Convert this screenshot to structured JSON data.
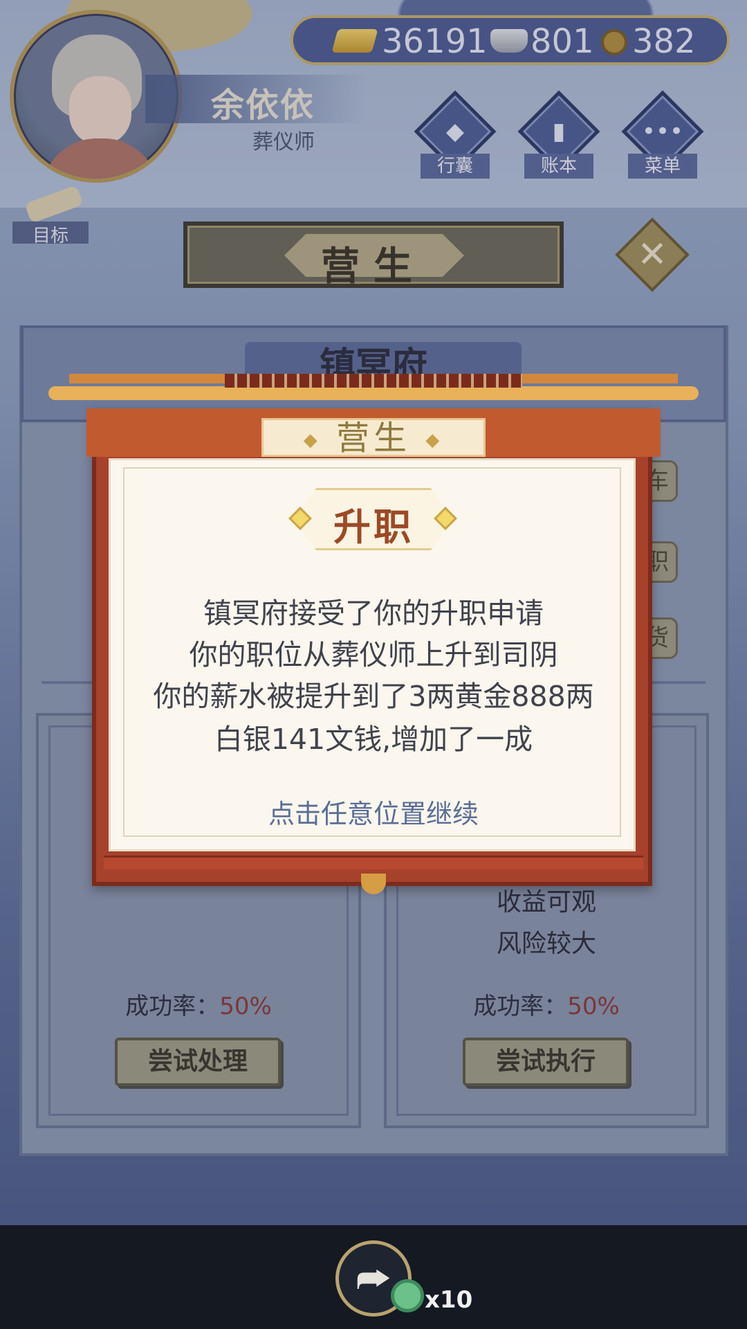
{
  "player": {
    "name": "余依依",
    "title": "葬仪师"
  },
  "currency": {
    "gold": "36191",
    "silver": "801",
    "coins": "382"
  },
  "top_menu": {
    "bag": "行囊",
    "ledger": "账本",
    "menu": "菜单"
  },
  "goal": {
    "label": "目标"
  },
  "screen": {
    "header": "营生",
    "panel_title": "镇冥府"
  },
  "cards": [
    {
      "desc_lines": [],
      "rate_label": "成功率：",
      "rate_value": "50%",
      "button": "尝试处理"
    },
    {
      "desc_lines": [
        "收益可观",
        "风险较大"
      ],
      "rate_label": "成功率：",
      "rate_value": "50%",
      "button": "尝试执行"
    }
  ],
  "side_buttons": [
    "车",
    "职",
    "货"
  ],
  "modal": {
    "tab": "营生",
    "badge": "升职",
    "lines": [
      "镇冥府接受了你的升职申请",
      "你的职位从葬仪师上升到司阴",
      "你的薪水被提升到了3两黄金888两",
      "白银141文钱,增加了一成"
    ],
    "continue": "点击任意位置继续"
  },
  "bottom": {
    "multiplier": "x10"
  },
  "colors": {
    "modal_red": "#a6412c",
    "accent_gold": "#c9b06d",
    "rate_red": "#8c3a36",
    "continue_blue": "#5a6e96"
  },
  "icons": [
    "gold-ingot-icon",
    "silver-ingot-icon",
    "copper-coin-icon",
    "bag-icon",
    "ledger-icon",
    "menu-icon",
    "scroll-icon",
    "close-icon",
    "share-icon",
    "jade-icon"
  ]
}
